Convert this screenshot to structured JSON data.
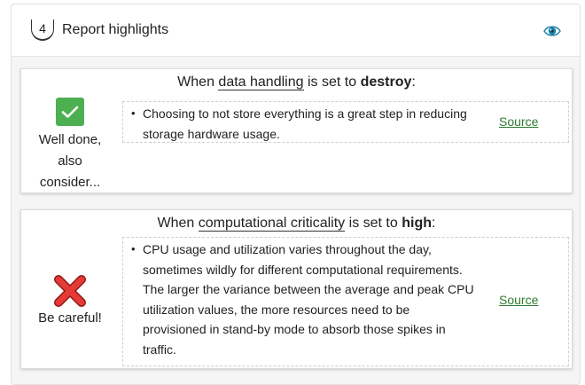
{
  "panel": {
    "step_number": "4",
    "title": "Report highlights",
    "eye_icon": "eye-icon",
    "accent_color": "#1a7fa8"
  },
  "highlights": [
    {
      "heading": {
        "prefix": "When",
        "term": "data handling",
        "middle": "is set to",
        "value": "destroy",
        "suffix": ":"
      },
      "verdict": {
        "icon": "checkmark-icon",
        "color": "#4caf50",
        "label_line1": "Well done,",
        "label_line2": "also",
        "label_line3": "consider..."
      },
      "tip": "Choosing to not store everything is a great step in reducing storage hardware usage.",
      "source_label": "Source"
    },
    {
      "heading": {
        "prefix": "When",
        "term": "computational criticality",
        "middle": "is set to",
        "value": "high",
        "suffix": ":"
      },
      "verdict": {
        "icon": "cross-icon",
        "color": "#e53935",
        "label_line1": "Be careful!"
      },
      "tip": "CPU usage and utilization varies throughout the day, sometimes wildly for different computational requirements. The larger the variance between the average and peak CPU utilization values, the more resources need to be provisioned in stand-by mode to absorb those spikes in traffic.",
      "source_label": "Source"
    }
  ]
}
